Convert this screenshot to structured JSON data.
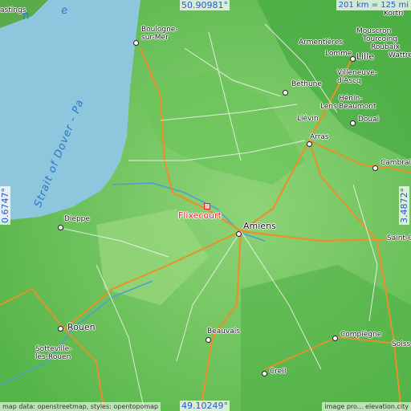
{
  "colors": {
    "sea": "#8ec7dd",
    "land_low": "#7fcf6a",
    "land_high": "#3fa63c",
    "motorway": "#e8902a",
    "road": "#f5f5f0",
    "highlight": "#e8202a",
    "coord_text": "#2855d0"
  },
  "coords": {
    "top_lat": "50.90981°",
    "bottom_lat": "49.10249°",
    "left_lon": "0.6747°",
    "right_lon": "3.4872°"
  },
  "scale_text": "201 km = 125 mi",
  "highlight_city": "Flixecourt",
  "sea_labels": {
    "strait": "Strait of Dover - Pa",
    "corner": "h e"
  },
  "cities": {
    "hastings": "astings",
    "boulogne": "Boulogne-sur-Mer",
    "armentieres": "Armentières",
    "kortrijk": "Kortri",
    "mouscron": "Mouscron",
    "tourcoing": "Tourcoing",
    "roubaix": "Roubaix",
    "lomme": "Lomme",
    "lille": "Lille",
    "wattre": "Wattre",
    "villeneuve": "Villeneuve-d'Ascq",
    "bethune": "Béthune",
    "henin": "Hénin-",
    "lens": "Lens",
    "beaumont": "Beaumont",
    "lievin": "Liévin",
    "douai": "Douai",
    "arras": "Arras",
    "cambrai": "Cambrai",
    "dieppe": "Dieppe",
    "amiens": "Amiens",
    "saint_q": "Saint-Q",
    "rouen": "Rouen",
    "sotteville": "Sotteville-lès-Rouen",
    "beauvais": "Beauvais",
    "compiegne": "Compiègne",
    "soissons": "Soiss",
    "creil": "Creil"
  },
  "attribution_left": "map data: openstreetmap, styles: opentopomap",
  "attribution_right": "image pro... elevation.city"
}
